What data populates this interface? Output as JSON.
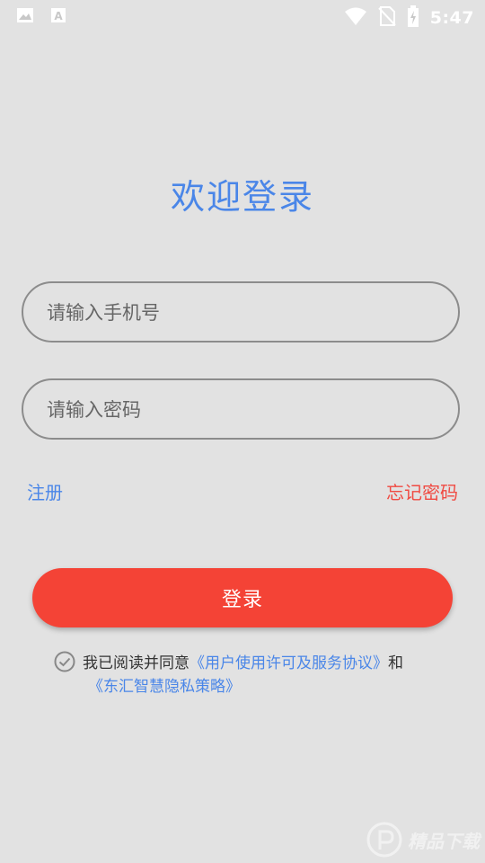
{
  "status_bar": {
    "time": "5:47",
    "icons": [
      "image-icon",
      "text-a-icon",
      "wifi-icon",
      "no-sim-icon",
      "battery-charging-icon"
    ]
  },
  "login": {
    "title": "欢迎登录",
    "phone_placeholder": "请输入手机号",
    "password_placeholder": "请输入密码",
    "register_link": "注册",
    "forgot_link": "忘记密码",
    "login_button": "登录"
  },
  "agreement": {
    "checked": true,
    "prefix": "我已阅读并同意",
    "user_agreement": "《用户使用许可及服务协议》",
    "conjunction": "和",
    "privacy_policy": "《东汇智慧隐私策略》"
  },
  "watermark": {
    "text": "精品下载"
  },
  "colors": {
    "background": "#e2e2e2",
    "title_blue": "#4a86e8",
    "link_blue": "#4a86e8",
    "forgot_red": "#f04a42",
    "button_red": "#f44336"
  }
}
